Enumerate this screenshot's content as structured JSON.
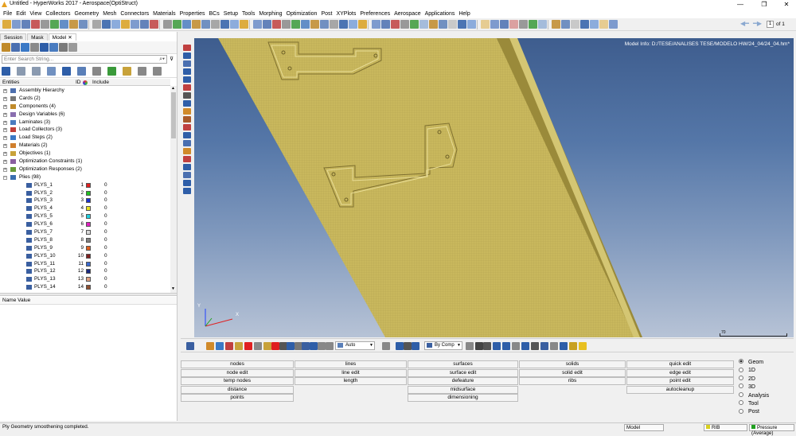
{
  "window": {
    "title": "Untitled - HyperWorks 2017 - Aerospace(OptiStruct)",
    "controls": [
      "—",
      "❐",
      "✕"
    ]
  },
  "menu": [
    "File",
    "Edit",
    "View",
    "Collectors",
    "Geometry",
    "Mesh",
    "Connectors",
    "Materials",
    "Properties",
    "BCs",
    "Setup",
    "Tools",
    "Morphing",
    "Optimization",
    "Post",
    "XYPlots",
    "Preferences",
    "Aerospace",
    "Applications",
    "Help"
  ],
  "page_nav": {
    "value": "1",
    "suffix": "of 1"
  },
  "browser": {
    "tabs": [
      {
        "label": "Session"
      },
      {
        "label": "Mask"
      },
      {
        "label": "Model"
      }
    ],
    "close_glyph": "✕",
    "search_placeholder": "Enter Search String...",
    "columns": {
      "entities": "Entities",
      "id": "ID",
      "include": "Include"
    },
    "entities": [
      {
        "label": "Assembly Hierarchy",
        "expand": "+",
        "icon_color": "#4d6fae"
      },
      {
        "label": "Cards (2)",
        "expand": "+",
        "icon_color": "#777777"
      },
      {
        "label": "Components (4)",
        "expand": "+",
        "icon_color": "#c08a2a"
      },
      {
        "label": "Design Variables (6)",
        "expand": "+",
        "icon_color": "#8a6fb0"
      },
      {
        "label": "Laminates (3)",
        "expand": "+",
        "icon_color": "#4a7cc0"
      },
      {
        "label": "Load Collectors (3)",
        "expand": "+",
        "icon_color": "#c0403a"
      },
      {
        "label": "Load Steps (2)",
        "expand": "+",
        "icon_color": "#3a79c6"
      },
      {
        "label": "Materials (2)",
        "expand": "+",
        "icon_color": "#d07f2d"
      },
      {
        "label": "Objectives (1)",
        "expand": "+",
        "icon_color": "#c8a23a"
      },
      {
        "label": "Optimization Constraints (1)",
        "expand": "+",
        "icon_color": "#8a5fa0"
      },
      {
        "label": "Optimization Responses (2)",
        "expand": "+",
        "icon_color": "#6a9a3a"
      },
      {
        "label": "Plies (98)",
        "expand": "−",
        "icon_color": "#3a6fb0"
      }
    ],
    "plies": [
      {
        "name": "PLYS_1",
        "id": "1",
        "color": "#e02020",
        "include": "0"
      },
      {
        "name": "PLYS_2",
        "id": "2",
        "color": "#20c020",
        "include": "0"
      },
      {
        "name": "PLYS_3",
        "id": "3",
        "color": "#1a30d0",
        "include": "0"
      },
      {
        "name": "PLYS_4",
        "id": "4",
        "color": "#e8e020",
        "include": "0"
      },
      {
        "name": "PLYS_5",
        "id": "5",
        "color": "#20d0e0",
        "include": "0"
      },
      {
        "name": "PLYS_6",
        "id": "6",
        "color": "#e020c0",
        "include": "0"
      },
      {
        "name": "PLYS_7",
        "id": "7",
        "color": "#d8d8d8",
        "include": "0"
      },
      {
        "name": "PLYS_8",
        "id": "8",
        "color": "#808080",
        "include": "0"
      },
      {
        "name": "PLYS_9",
        "id": "9",
        "color": "#e06020",
        "include": "0"
      },
      {
        "name": "PLYS_10",
        "id": "10",
        "color": "#802020",
        "include": "0"
      },
      {
        "name": "PLYS_11",
        "id": "11",
        "color": "#3a6ad0",
        "include": "0"
      },
      {
        "name": "PLYS_12",
        "id": "12",
        "color": "#1a2a80",
        "include": "0"
      },
      {
        "name": "PLYS_13",
        "id": "13",
        "color": "#e0a080",
        "include": "0"
      },
      {
        "name": "PLYS_14",
        "id": "14",
        "color": "#905030",
        "include": "0"
      }
    ],
    "name_value_header": "Name Value"
  },
  "graphics": {
    "model_info": "Model Info: D:/TESE/ANALISES TESE/MODELO HW/24_04/24_04.hm*",
    "triad": {
      "y": "Y",
      "x": "X"
    },
    "scale_label": "70"
  },
  "bottom_toolbar": {
    "auto_label": "Auto",
    "by_comp_label": "By Comp"
  },
  "panel_buttons": [
    [
      "nodes",
      "node edit",
      "temp nodes",
      "distance",
      "points"
    ],
    [
      "lines",
      "line edit",
      "length"
    ],
    [
      "surfaces",
      "surface edit",
      "defeature",
      "midsurface",
      "dimensioning"
    ],
    [
      "solids",
      "solid edit",
      "ribs"
    ],
    [
      "quick edit",
      "edge edit",
      "point edit",
      "autocleanup"
    ]
  ],
  "page_radios": [
    {
      "label": "Geom",
      "selected": true
    },
    {
      "label": "1D",
      "selected": false
    },
    {
      "label": "2D",
      "selected": false
    },
    {
      "label": "3D",
      "selected": false
    },
    {
      "label": "Analysis",
      "selected": false
    },
    {
      "label": "Tool",
      "selected": false
    },
    {
      "label": "Post",
      "selected": false
    }
  ],
  "status": {
    "message": "Ply Geometry smoothening completed.",
    "model": "Model",
    "component": "RIB",
    "load": "Pressure (Average)",
    "component_color": "#d8d020",
    "load_color": "#20a020"
  }
}
